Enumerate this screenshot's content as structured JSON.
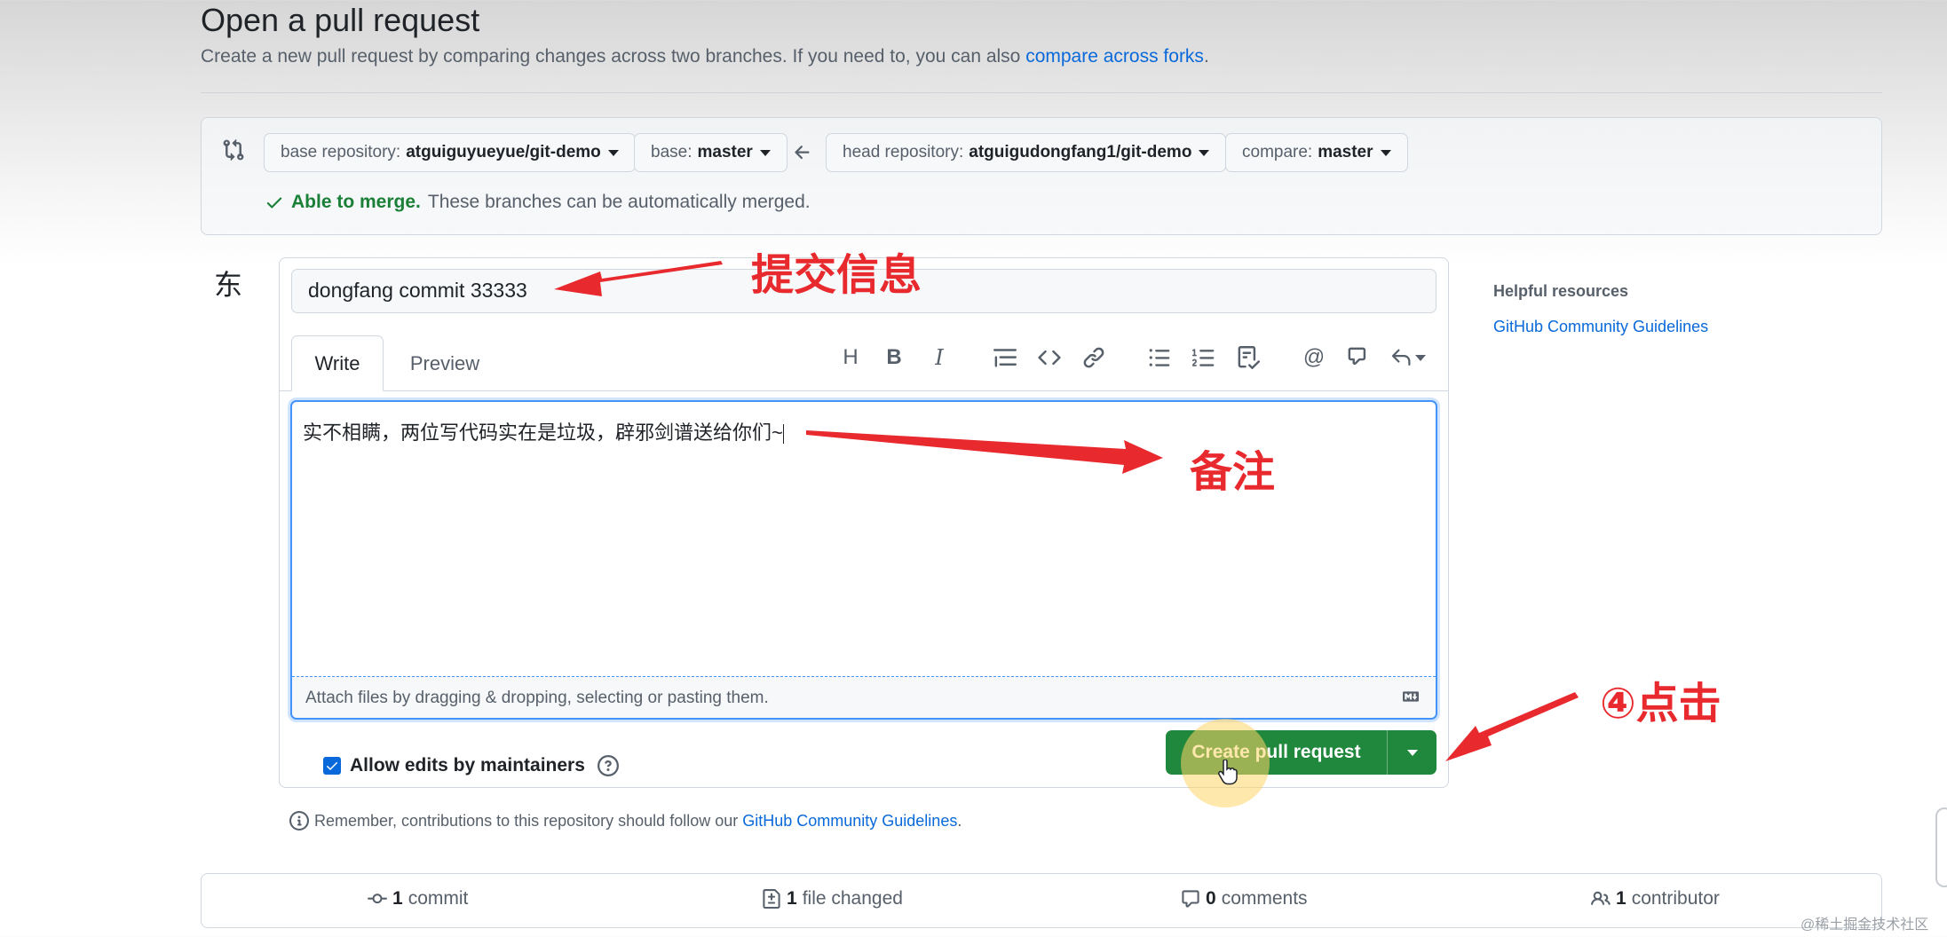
{
  "header": {
    "title": "Open a pull request",
    "subtitle": "Create a new pull request by comparing changes across two branches. If you need to, you can also ",
    "subtitle_link": "compare across forks",
    "subtitle_end": "."
  },
  "compare": {
    "base_repo_label": "base repository:",
    "base_repo_value": "atguiguyueyue/git-demo",
    "base_label": "base:",
    "base_value": "master",
    "head_repo_label": "head repository:",
    "head_repo_value": "atguigudongfang1/git-demo",
    "compare_label": "compare:",
    "compare_value": "master",
    "merge_ok": "Able to merge.",
    "merge_text": "These branches can be automatically merged."
  },
  "avatar": {
    "text": "东"
  },
  "form": {
    "title_value": "dongfang commit 33333",
    "tabs": [
      {
        "label": "Write"
      },
      {
        "label": "Preview"
      }
    ],
    "body_value": "实不相瞒，两位写代码实在是垃圾，辟邪剑谱送给你们~",
    "attach_text": "Attach files by dragging & dropping, selecting or pasting them.",
    "allow_edits_label": "Allow edits by maintainers",
    "create_button_label": "Create pull request"
  },
  "remember": {
    "text": "Remember, contributions to this repository should follow our ",
    "link": "GitHub Community Guidelines",
    "end": "."
  },
  "sidebar": {
    "title": "Helpful resources",
    "link": "GitHub Community Guidelines"
  },
  "summary": {
    "commits_count": "1",
    "commits_label": "commit",
    "files_count": "1",
    "files_label": "file changed",
    "comments_count": "0",
    "comments_label": "comments",
    "contributors_count": "1",
    "contributors_label": "contributor"
  },
  "annotations": {
    "commit_info": "提交信息",
    "note": "备注",
    "click": "④点击"
  },
  "watermark": "@稀土掘金技术社区",
  "colors": {
    "accent_blue": "#0969da",
    "primary_green": "#1f883d",
    "annotation_red": "#e8292d"
  },
  "icons": {
    "toolbar": [
      "heading-icon",
      "bold-icon",
      "italic-icon",
      "quote-icon",
      "code-icon",
      "link-icon",
      "unordered-list-icon",
      "ordered-list-icon",
      "task-list-icon",
      "mention-icon",
      "reference-icon",
      "reply-icon"
    ]
  }
}
